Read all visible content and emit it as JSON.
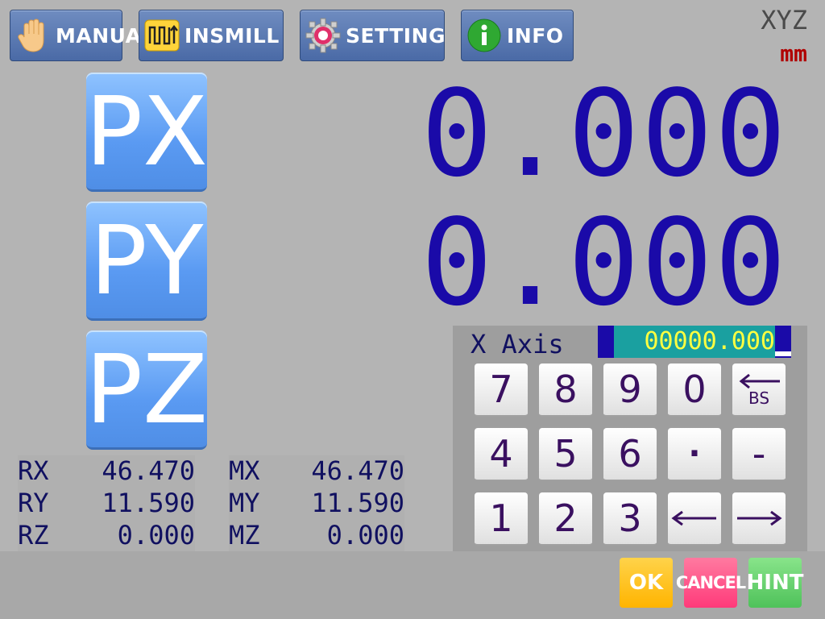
{
  "tabs": [
    {
      "label": "MANUAL",
      "icon": "hand-icon"
    },
    {
      "label": "INSMILL",
      "icon": "insmill-icon"
    },
    {
      "label": "SETTING",
      "icon": "gear-icon"
    },
    {
      "label": "INFO",
      "icon": "info-icon"
    }
  ],
  "header": {
    "mode": "XYZ",
    "unit": "mm"
  },
  "axis_buttons": {
    "px": "PX",
    "py": "PY",
    "pz": "PZ"
  },
  "readouts": {
    "x": "0.000",
    "y": "0.000"
  },
  "coords": [
    {
      "r_label": "RX",
      "r_value": "46.470",
      "m_label": "MX",
      "m_value": "46.470"
    },
    {
      "r_label": "RY",
      "r_value": "11.590",
      "m_label": "MY",
      "m_value": "11.590"
    },
    {
      "r_label": "RZ",
      "r_value": "0.000",
      "m_label": "MZ",
      "m_value": "0.000"
    }
  ],
  "entry": {
    "axis_label": "X Axis",
    "value": "00000.000"
  },
  "keypad": {
    "k7": "7",
    "k8": "8",
    "k9": "9",
    "k0": "0",
    "bs": "BS",
    "k4": "4",
    "k5": "5",
    "k6": "6",
    "dot": "·",
    "minus": "-",
    "k1": "1",
    "k2": "2",
    "k3": "3",
    "left": "←",
    "right": "→"
  },
  "actions": {
    "ok": "OK",
    "cancel": "CANCEL",
    "hint": "HINT"
  },
  "colors": {
    "readout": "#1a0aa8",
    "tab": "#4a6aa6",
    "axis_button": "#5a9af2",
    "unit": "#b00000"
  }
}
